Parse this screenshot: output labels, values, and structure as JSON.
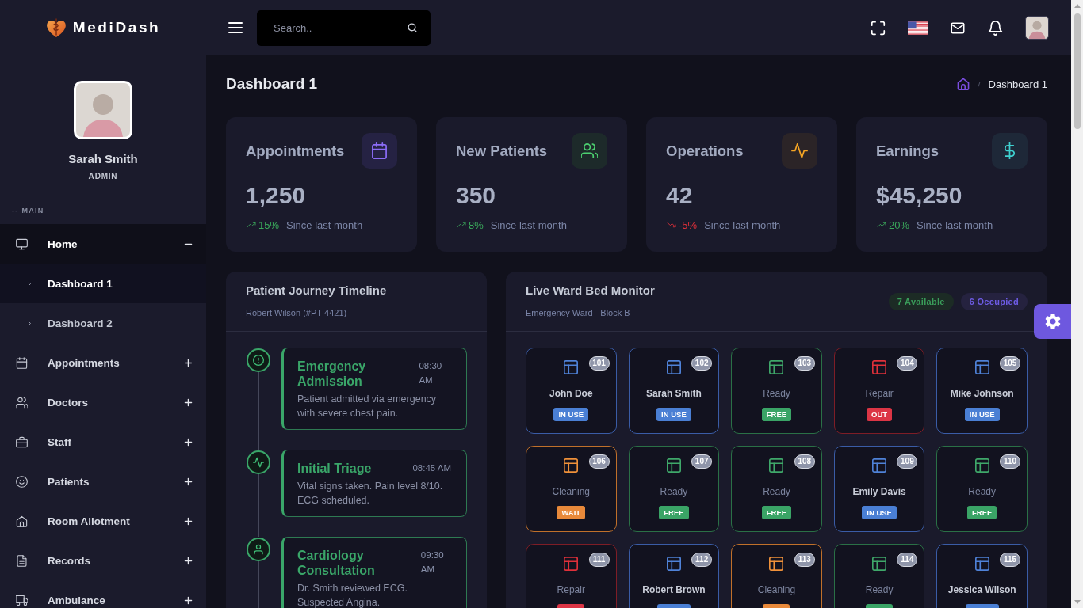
{
  "header": {
    "logo": "MediDash",
    "search": {
      "placeholder": "Search.."
    }
  },
  "sidebar": {
    "user": {
      "name": "Sarah Smith",
      "role": "ADMIN"
    },
    "section": "-- MAIN",
    "items": [
      {
        "label": "Home",
        "selected": true,
        "expanded": true,
        "children": [
          {
            "label": "Dashboard 1",
            "selected": true
          },
          {
            "label": "Dashboard 2",
            "selected": false
          }
        ]
      },
      {
        "label": "Appointments",
        "selected": false,
        "expanded": false
      },
      {
        "label": "Doctors",
        "selected": false,
        "expanded": false
      },
      {
        "label": "Staff",
        "selected": false,
        "expanded": false
      },
      {
        "label": "Patients",
        "selected": false,
        "expanded": false
      },
      {
        "label": "Room Allotment",
        "selected": false,
        "expanded": false
      },
      {
        "label": "Records",
        "selected": false,
        "expanded": false
      },
      {
        "label": "Ambulance",
        "selected": false,
        "expanded": false
      }
    ]
  },
  "page": {
    "title": "Dashboard 1",
    "breadcrumb": [
      {
        "label": "Dashboard 1"
      }
    ]
  },
  "stats": [
    {
      "title": "Appointments",
      "value": "1,250",
      "change": "15%",
      "rising": true,
      "note": "Since last month"
    },
    {
      "title": "New Patients",
      "value": "350",
      "change": "8%",
      "rising": true,
      "note": "Since last month"
    },
    {
      "title": "Operations",
      "value": "42",
      "change": "-5%",
      "rising": false,
      "note": "Since last month"
    },
    {
      "title": "Earnings",
      "value": "$45,250",
      "change": "20%",
      "rising": true,
      "note": "Since last month"
    }
  ],
  "timeline": {
    "title": "Patient Journey Timeline",
    "subtitle": "Robert Wilson (#PT-4421)",
    "events": [
      {
        "title": "Emergency Admission",
        "time": "08:30 AM",
        "text": "Patient admitted via emergency with severe chest pain."
      },
      {
        "title": "Initial Triage",
        "time": "08:45 AM",
        "text": "Vital signs taken. Pain level 8/10. ECG scheduled."
      },
      {
        "title": "Cardiology Consultation",
        "time": "09:30 AM",
        "text": "Dr. Smith reviewed ECG. Suspected Angina."
      }
    ]
  },
  "ward": {
    "title": "Live Ward Bed Monitor",
    "subtitle": "Emergency Ward - Block B",
    "summary": [
      {
        "label": "7 Available",
        "kind": "available"
      },
      {
        "label": "6 Occupied",
        "kind": "occupied"
      }
    ],
    "beds": [
      {
        "number": "101",
        "label": "John Doe",
        "kind": "occupied",
        "tag": "IN USE"
      },
      {
        "number": "102",
        "label": "Sarah Smith",
        "kind": "occupied",
        "tag": "IN USE"
      },
      {
        "number": "103",
        "label": "Ready",
        "kind": "free",
        "tag": "FREE"
      },
      {
        "number": "104",
        "label": "Repair",
        "kind": "repair",
        "tag": "OUT"
      },
      {
        "number": "105",
        "label": "Mike Johnson",
        "kind": "occupied",
        "tag": "IN USE"
      },
      {
        "number": "106",
        "label": "Cleaning",
        "kind": "cleaning",
        "tag": "WAIT"
      },
      {
        "number": "107",
        "label": "Ready",
        "kind": "free",
        "tag": "FREE"
      },
      {
        "number": "108",
        "label": "Ready",
        "kind": "free",
        "tag": "FREE"
      },
      {
        "number": "109",
        "label": "Emily Davis",
        "kind": "occupied",
        "tag": "IN USE"
      },
      {
        "number": "110",
        "label": "Ready",
        "kind": "free",
        "tag": "FREE"
      },
      {
        "number": "111",
        "label": "Repair",
        "kind": "repair"
      },
      {
        "number": "112",
        "label": "Robert Brown",
        "kind": "occupied"
      },
      {
        "number": "113",
        "label": "Cleaning",
        "kind": "cleaning"
      },
      {
        "number": "114",
        "label": "Ready",
        "kind": "free"
      },
      {
        "number": "115",
        "label": "Jessica Wilson",
        "kind": "occupied"
      }
    ]
  }
}
